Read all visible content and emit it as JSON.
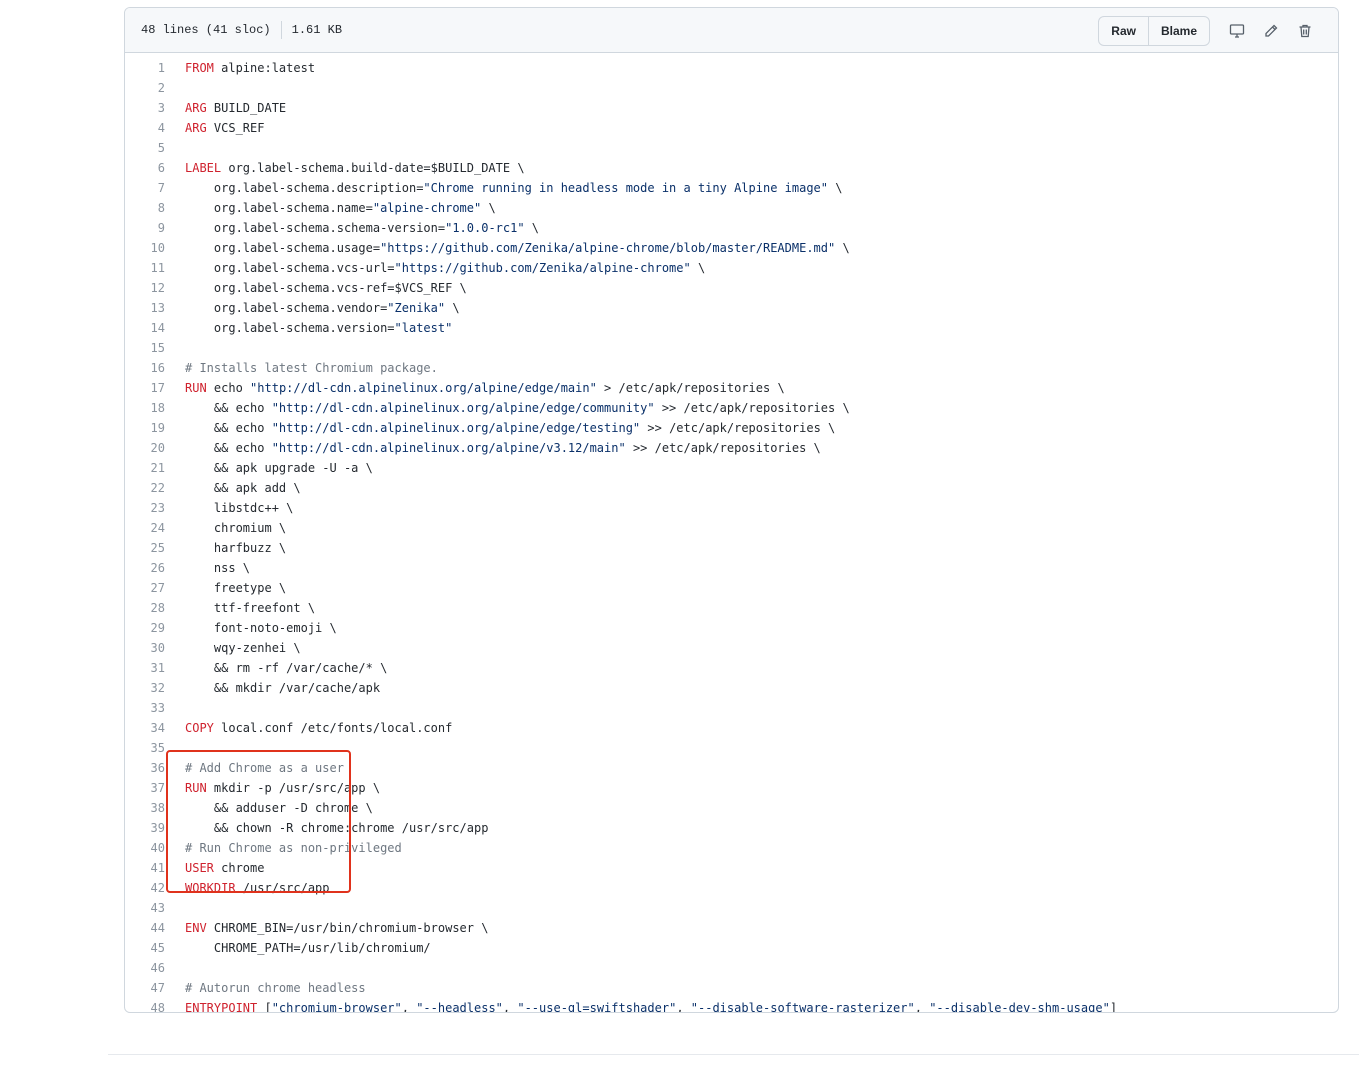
{
  "file": {
    "lines_info": "48 lines (41 sloc)",
    "size": "1.61 KB"
  },
  "toolbar": {
    "raw_label": "Raw",
    "blame_label": "Blame",
    "icons": [
      "desktop-icon",
      "pencil-icon",
      "trash-icon"
    ]
  },
  "colors": {
    "keyword": "#cf222e",
    "string": "#0a3069",
    "comment": "#6e7781",
    "highlight_box": "#e0321c"
  },
  "code": [
    [
      [
        "k",
        "FROM"
      ],
      [
        "t",
        " alpine:latest"
      ]
    ],
    [],
    [
      [
        "k",
        "ARG"
      ],
      [
        "t",
        " BUILD_DATE"
      ]
    ],
    [
      [
        "k",
        "ARG"
      ],
      [
        "t",
        " VCS_REF"
      ]
    ],
    [],
    [
      [
        "k",
        "LABEL"
      ],
      [
        "t",
        " org.label-schema.build-date=$BUILD_DATE \\"
      ]
    ],
    [
      [
        "t",
        "    org.label-schema.description="
      ],
      [
        "s",
        "\"Chrome running in headless mode in a tiny Alpine image\""
      ],
      [
        "t",
        " \\"
      ]
    ],
    [
      [
        "t",
        "    org.label-schema.name="
      ],
      [
        "s",
        "\"alpine-chrome\""
      ],
      [
        "t",
        " \\"
      ]
    ],
    [
      [
        "t",
        "    org.label-schema.schema-version="
      ],
      [
        "s",
        "\"1.0.0-rc1\""
      ],
      [
        "t",
        " \\"
      ]
    ],
    [
      [
        "t",
        "    org.label-schema.usage="
      ],
      [
        "s",
        "\"https://github.com/Zenika/alpine-chrome/blob/master/README.md\""
      ],
      [
        "t",
        " \\"
      ]
    ],
    [
      [
        "t",
        "    org.label-schema.vcs-url="
      ],
      [
        "s",
        "\"https://github.com/Zenika/alpine-chrome\""
      ],
      [
        "t",
        " \\"
      ]
    ],
    [
      [
        "t",
        "    org.label-schema.vcs-ref=$VCS_REF \\"
      ]
    ],
    [
      [
        "t",
        "    org.label-schema.vendor="
      ],
      [
        "s",
        "\"Zenika\""
      ],
      [
        "t",
        " \\"
      ]
    ],
    [
      [
        "t",
        "    org.label-schema.version="
      ],
      [
        "s",
        "\"latest\""
      ]
    ],
    [],
    [
      [
        "c",
        "# Installs latest Chromium package."
      ]
    ],
    [
      [
        "k",
        "RUN"
      ],
      [
        "t",
        " echo "
      ],
      [
        "s",
        "\"http://dl-cdn.alpinelinux.org/alpine/edge/main\""
      ],
      [
        "t",
        " > /etc/apk/repositories \\"
      ]
    ],
    [
      [
        "t",
        "    && echo "
      ],
      [
        "s",
        "\"http://dl-cdn.alpinelinux.org/alpine/edge/community\""
      ],
      [
        "t",
        " >> /etc/apk/repositories \\"
      ]
    ],
    [
      [
        "t",
        "    && echo "
      ],
      [
        "s",
        "\"http://dl-cdn.alpinelinux.org/alpine/edge/testing\""
      ],
      [
        "t",
        " >> /etc/apk/repositories \\"
      ]
    ],
    [
      [
        "t",
        "    && echo "
      ],
      [
        "s",
        "\"http://dl-cdn.alpinelinux.org/alpine/v3.12/main\""
      ],
      [
        "t",
        " >> /etc/apk/repositories \\"
      ]
    ],
    [
      [
        "t",
        "    && apk upgrade -U -a \\"
      ]
    ],
    [
      [
        "t",
        "    && apk add \\"
      ]
    ],
    [
      [
        "t",
        "    libstdc++ \\"
      ]
    ],
    [
      [
        "t",
        "    chromium \\"
      ]
    ],
    [
      [
        "t",
        "    harfbuzz \\"
      ]
    ],
    [
      [
        "t",
        "    nss \\"
      ]
    ],
    [
      [
        "t",
        "    freetype \\"
      ]
    ],
    [
      [
        "t",
        "    ttf-freefont \\"
      ]
    ],
    [
      [
        "t",
        "    font-noto-emoji \\"
      ]
    ],
    [
      [
        "t",
        "    wqy-zenhei \\"
      ]
    ],
    [
      [
        "t",
        "    && rm -rf /var/cache/* \\"
      ]
    ],
    [
      [
        "t",
        "    && mkdir /var/cache/apk"
      ]
    ],
    [],
    [
      [
        "k",
        "COPY"
      ],
      [
        "t",
        " local.conf /etc/fonts/local.conf"
      ]
    ],
    [],
    [
      [
        "c",
        "# Add Chrome as a user"
      ]
    ],
    [
      [
        "k",
        "RUN"
      ],
      [
        "t",
        " mkdir -p /usr/src/app \\"
      ]
    ],
    [
      [
        "t",
        "    && adduser -D chrome \\"
      ]
    ],
    [
      [
        "t",
        "    && chown -R chrome:chrome /usr/src/app"
      ]
    ],
    [
      [
        "c",
        "# Run Chrome as non-privileged"
      ]
    ],
    [
      [
        "k",
        "USER"
      ],
      [
        "t",
        " chrome"
      ]
    ],
    [
      [
        "k",
        "WORKDIR"
      ],
      [
        "t",
        " /usr/src/app"
      ]
    ],
    [],
    [
      [
        "k",
        "ENV"
      ],
      [
        "t",
        " CHROME_BIN=/usr/bin/chromium-browser \\"
      ]
    ],
    [
      [
        "t",
        "    CHROME_PATH=/usr/lib/chromium/"
      ]
    ],
    [],
    [
      [
        "c",
        "# Autorun chrome headless"
      ]
    ],
    [
      [
        "k",
        "ENTRYPOINT"
      ],
      [
        "t",
        " ["
      ],
      [
        "s",
        "\"chromium-browser\""
      ],
      [
        "t",
        ", "
      ],
      [
        "s",
        "\"--headless\""
      ],
      [
        "t",
        ", "
      ],
      [
        "s",
        "\"--use-gl=swiftshader\""
      ],
      [
        "t",
        ", "
      ],
      [
        "s",
        "\"--disable-software-rasterizer\""
      ],
      [
        "t",
        ", "
      ],
      [
        "s",
        "\"--disable-dev-shm-usage\""
      ],
      [
        "t",
        "]"
      ]
    ]
  ]
}
